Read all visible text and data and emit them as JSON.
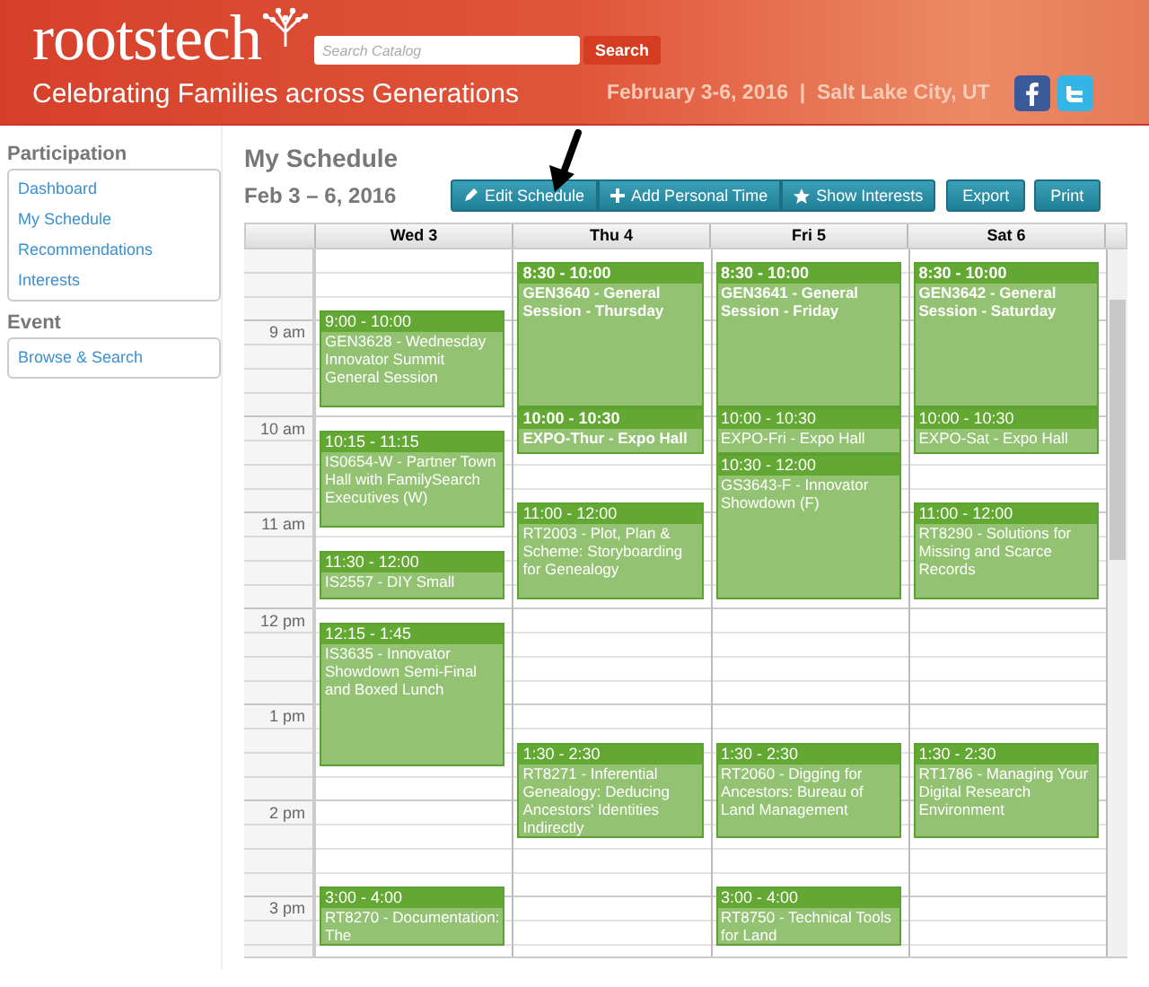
{
  "header": {
    "logo": "rootstech",
    "search": {
      "placeholder": "Search Catalog",
      "button": "Search"
    },
    "tagline": "Celebrating Families across Generations",
    "event_info": "February 3-6, 2016  |  Salt Lake City, UT"
  },
  "sidebar": [
    {
      "title": "Participation",
      "items": [
        {
          "label": "Dashboard"
        },
        {
          "label": "My Schedule"
        },
        {
          "label": "Recommendations"
        },
        {
          "label": "Interests"
        }
      ]
    },
    {
      "title": "Event",
      "items": [
        {
          "label": "Browse & Search"
        }
      ]
    }
  ],
  "page_title": "My Schedule",
  "date_range": "Feb 3 – 6, 2016",
  "toolbar": {
    "group": [
      {
        "label": "Edit Schedule"
      },
      {
        "label": "Add Personal Time"
      },
      {
        "label": "Show Interests"
      }
    ],
    "buttons": [
      "Export",
      "Print"
    ]
  },
  "calendar": {
    "hours": [
      "9 am",
      "10 am",
      "11 am",
      "12 pm",
      "1 pm",
      "2 pm",
      "3 pm"
    ],
    "days": [
      {
        "label": "Wed 3",
        "events": [
          {
            "time": "9:00 - 10:00",
            "title": "GEN3628 - Wednesday Innovator Summit General Session",
            "bold": false
          },
          {
            "time": "10:15 - 11:15",
            "title": "IS0654-W - Partner Town Hall with FamilySearch Executives (W)",
            "bold": false
          },
          {
            "time": "11:30 - 12:00",
            "title": "IS2557 - DIY Small",
            "bold": false
          },
          {
            "time": "12:15 - 1:45",
            "title": "IS3635 - Innovator Showdown Semi-Final and Boxed Lunch",
            "bold": false
          },
          {
            "time": "3:00 - 4:00",
            "title": "RT8270 - Documentation: The",
            "bold": false
          }
        ]
      },
      {
        "label": "Thu 4",
        "events": [
          {
            "time": "8:30 - 10:00",
            "title": "GEN3640 - General Session - Thursday",
            "bold": true
          },
          {
            "time": "10:00 - 10:30",
            "title": "EXPO-Thur - Expo Hall",
            "bold": true
          },
          {
            "time": "11:00 - 12:00",
            "title": "RT2003 - Plot, Plan & Scheme: Storyboarding for Genealogy",
            "bold": false
          },
          {
            "time": "1:30 - 2:30",
            "title": "RT8271 - Inferential Genealogy: Deducing Ancestors' Identities Indirectly",
            "bold": false
          }
        ]
      },
      {
        "label": "Fri 5",
        "events": [
          {
            "time": "8:30 - 10:00",
            "title": "GEN3641 - General Session - Friday",
            "bold": true
          },
          {
            "time": "10:00 - 10:30",
            "title": "EXPO-Fri - Expo Hall",
            "bold": false
          },
          {
            "time": "10:30 - 12:00",
            "title": "GS3643-F - Innovator Showdown (F)",
            "bold": false
          },
          {
            "time": "1:30 - 2:30",
            "title": "RT2060 - Digging for Ancestors: Bureau of Land Management",
            "bold": false
          },
          {
            "time": "3:00 - 4:00",
            "title": "RT8750 - Technical Tools for Land",
            "bold": false
          }
        ]
      },
      {
        "label": "Sat 6",
        "events": [
          {
            "time": "8:30 - 10:00",
            "title": "GEN3642 - General Session - Saturday",
            "bold": true
          },
          {
            "time": "10:00 - 10:30",
            "title": "EXPO-Sat - Expo Hall",
            "bold": false
          },
          {
            "time": "11:00 - 12:00",
            "title": "RT8290 - Solutions for Missing and Scarce Records",
            "bold": false
          },
          {
            "time": "1:30 - 2:30",
            "title": "RT1786 - Managing Your Digital Research Environment",
            "bold": false
          }
        ]
      }
    ]
  }
}
